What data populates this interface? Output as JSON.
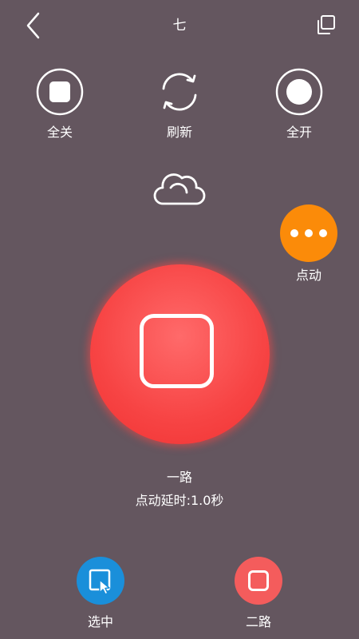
{
  "header": {
    "title": "七"
  },
  "actions": {
    "all_off_label": "全关",
    "refresh_label": "刷新",
    "all_on_label": "全开"
  },
  "jog": {
    "label": "点动"
  },
  "main": {
    "channel_name": "一路",
    "delay_text": "点动延时:1.0秒"
  },
  "bottom": {
    "select_label": "选中",
    "second_label": "二路"
  },
  "colors": {
    "background": "#64565f",
    "main_button": "#f74444",
    "jog_button": "#fb8b09",
    "select_button": "#1a8fda",
    "second_button": "#f45c5c"
  }
}
